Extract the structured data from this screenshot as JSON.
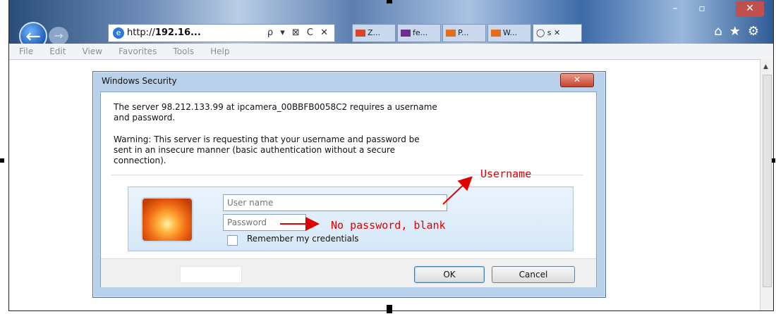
{
  "browser": {
    "url_prefix": "http://",
    "url_host": "192.16...",
    "addr_controls": "ρ ▾ ⊠ C ✕",
    "tabs": [
      {
        "label": "Z...",
        "color": "#d8442c"
      },
      {
        "label": "fe...",
        "color": "#6a2f8f"
      },
      {
        "label": "P...",
        "color": "#e07020"
      },
      {
        "label": "W...",
        "color": "#e07020"
      },
      {
        "label": "◯ s ✕",
        "color": "#c9d8ec"
      }
    ],
    "window_buttons": {
      "minimize": "–",
      "maximize": "▫",
      "close": "✕"
    },
    "tool_icons": "⌂★⚙"
  },
  "menu": [
    "File",
    "Edit",
    "View",
    "Favorites",
    "Tools",
    "Help"
  ],
  "dialog": {
    "title": "Windows Security",
    "close": "✕",
    "message1_line1": "The server 98.212.133.99 at ipcamera_00BBFB0058C2 requires a username",
    "message1_line2": "and password.",
    "warning_line1": "Warning: This server is requesting that your username and password be",
    "warning_line2": "sent in an insecure manner (basic authentication without a secure",
    "warning_line3": "connection).",
    "username_placeholder": "User name",
    "password_placeholder": "Password",
    "remember_label": "Remember my credentials",
    "ok_label": "OK",
    "cancel_label": "Cancel"
  },
  "annotations": {
    "username": "Username",
    "password": "No password, blank",
    "color": "#e00000"
  }
}
